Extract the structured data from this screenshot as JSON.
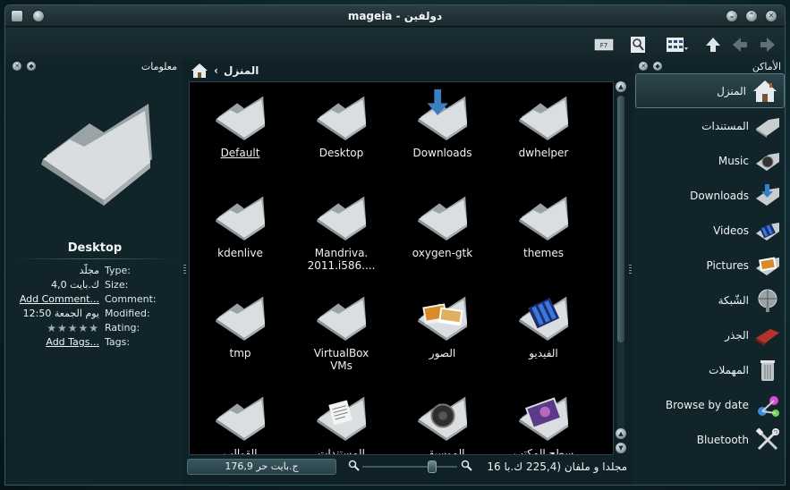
{
  "window": {
    "title": "mageia - دولفين"
  },
  "toolbar": {
    "buttons": [
      {
        "name": "back",
        "enabled": false
      },
      {
        "name": "forward",
        "enabled": false
      },
      {
        "name": "up",
        "enabled": true
      },
      {
        "name": "view-mode",
        "enabled": true
      },
      {
        "name": "preview",
        "enabled": true
      },
      {
        "name": "split",
        "enabled": true
      }
    ]
  },
  "info_panel": {
    "title": "معلومات",
    "name": "Desktop",
    "rows": [
      {
        "key": "Type:",
        "value": "مجلّد"
      },
      {
        "key": "Size:",
        "value": "4,0 ك.بايت"
      },
      {
        "key": "Comment:",
        "value": "Add Comment..."
      },
      {
        "key": "Modified:",
        "value": "يوم الجمعة 12:50"
      },
      {
        "key": "Rating:",
        "value": "★★★★★"
      },
      {
        "key": "Tags:",
        "value": "Add Tags..."
      }
    ]
  },
  "breadcrumb": {
    "label": "المنزل"
  },
  "items": [
    {
      "label": "Default",
      "type": "folder"
    },
    {
      "label": "Desktop",
      "type": "folder"
    },
    {
      "label": "Downloads",
      "type": "downloads"
    },
    {
      "label": "dwhelper",
      "type": "folder"
    },
    {
      "label": "kdenlive",
      "type": "folder"
    },
    {
      "label": "Mandriva.\n2011.i586....",
      "type": "folder"
    },
    {
      "label": "oxygen-gtk",
      "type": "folder"
    },
    {
      "label": "themes",
      "type": "folder"
    },
    {
      "label": "tmp",
      "type": "folder"
    },
    {
      "label": "VirtualBox\nVMs",
      "type": "folder"
    },
    {
      "label": "الصور",
      "type": "pictures"
    },
    {
      "label": "الفيديو",
      "type": "videos"
    },
    {
      "label": "القوالب",
      "type": "folder"
    },
    {
      "label": "المستندات",
      "type": "documents"
    },
    {
      "label": "الموسيقى",
      "type": "music"
    },
    {
      "label": "سطح المكتب",
      "type": "desktop"
    }
  ],
  "places_panel": {
    "title": "الأماكن",
    "items": [
      {
        "label": "المنزل",
        "icon": "home-icon",
        "active": true
      },
      {
        "label": "المستندات",
        "icon": "documents-folder-icon"
      },
      {
        "label": "Music",
        "icon": "music-folder-icon"
      },
      {
        "label": "Downloads",
        "icon": "downloads-folder-icon"
      },
      {
        "label": "Videos",
        "icon": "videos-folder-icon"
      },
      {
        "label": "Pictures",
        "icon": "pictures-folder-icon"
      },
      {
        "label": "الشّبكة",
        "icon": "network-icon"
      },
      {
        "label": "الجذر",
        "icon": "root-drive-icon"
      },
      {
        "label": "المهملات",
        "icon": "trash-icon"
      },
      {
        "label": "Browse by date",
        "icon": "calendar-graph-icon"
      },
      {
        "label": "Bluetooth",
        "icon": "bluetooth-tools-icon"
      }
    ]
  },
  "statusbar": {
    "free_space": "176,9 ج.بايت حر",
    "summary": "16 مجلدا و ملفان (225,4 ك.با"
  }
}
